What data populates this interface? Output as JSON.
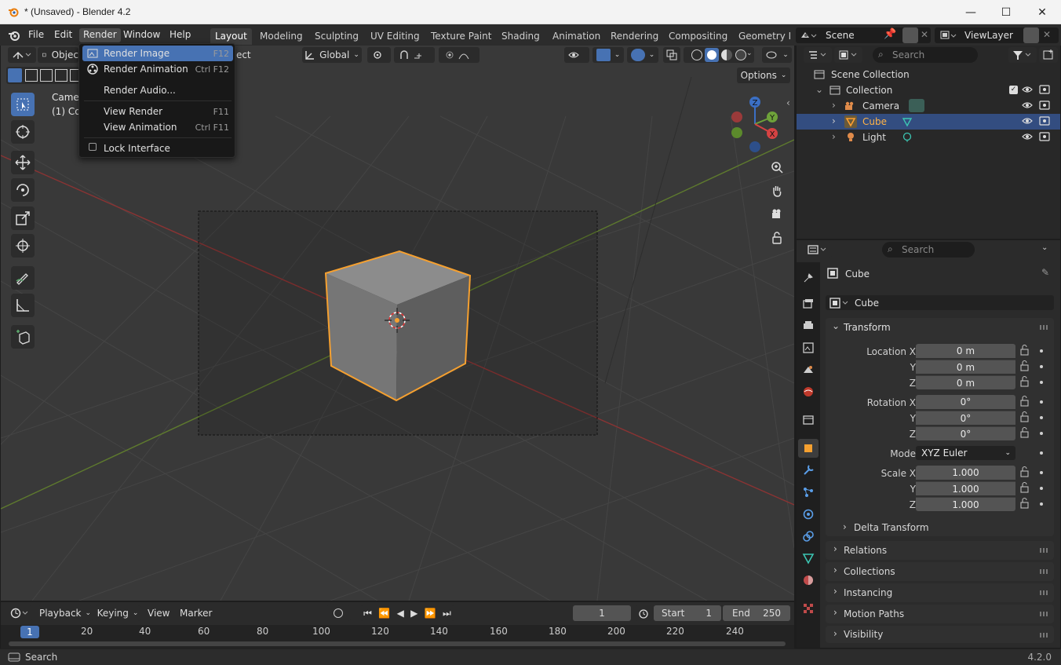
{
  "titlebar": {
    "title": "* (Unsaved) - Blender 4.2",
    "minimize": "—",
    "maximize": "☐",
    "close": "✕"
  },
  "menubar": {
    "items": [
      "File",
      "Edit",
      "Render",
      "Window",
      "Help"
    ]
  },
  "workspaces": [
    "Layout",
    "Modeling",
    "Sculpting",
    "UV Editing",
    "Texture Paint",
    "Shading",
    "Animation",
    "Rendering",
    "Compositing",
    "Geometry No"
  ],
  "scene": {
    "name": "Scene",
    "view_layer": "ViewLayer"
  },
  "viewport": {
    "mode_label": "Objec",
    "mode_partial": "Object",
    "transform_orientation": "Global",
    "options_label": "Options",
    "overlay_text_1": "Camer",
    "overlay_text_2": "(1) Co",
    "gizmo": {
      "x": "X",
      "y": "Y",
      "z": "Z"
    }
  },
  "render_menu": {
    "items": [
      {
        "label": "Render Image",
        "shortcut": "F12"
      },
      {
        "label": "Render Animation",
        "shortcut": "Ctrl F12"
      },
      {
        "label": "Render Audio...",
        "shortcut": ""
      },
      {
        "label": "View Render",
        "shortcut": "F11"
      },
      {
        "label": "View Animation",
        "shortcut": "Ctrl F11"
      },
      {
        "label": "Lock Interface",
        "shortcut": ""
      }
    ]
  },
  "outliner": {
    "search_placeholder": "Search",
    "rows": [
      {
        "label": "Scene Collection"
      },
      {
        "label": "Collection"
      },
      {
        "label": "Camera"
      },
      {
        "label": "Cube"
      },
      {
        "label": "Light"
      }
    ]
  },
  "properties": {
    "search_placeholder": "Search",
    "object_name": "Cube",
    "data_name": "Cube",
    "transform_title": "Transform",
    "location_label": "Location X",
    "y_label": "Y",
    "z_label": "Z",
    "rotation_label": "Rotation X",
    "mode_label": "Mode",
    "scale_label": "Scale X",
    "location": [
      "0 m",
      "0 m",
      "0 m"
    ],
    "rotation": [
      "0°",
      "0°",
      "0°"
    ],
    "rotation_mode": "XYZ Euler",
    "scale": [
      "1.000",
      "1.000",
      "1.000"
    ],
    "delta_transform": "Delta Transform",
    "sections": [
      "Relations",
      "Collections",
      "Instancing",
      "Motion Paths",
      "Visibility"
    ]
  },
  "timeline": {
    "menus": [
      "Playback",
      "Keying",
      "View",
      "Marker"
    ],
    "current_frame": "1",
    "start_label": "Start",
    "start": "1",
    "end_label": "End",
    "end": "250",
    "ruler": [
      "1",
      "20",
      "40",
      "60",
      "80",
      "100",
      "120",
      "140",
      "160",
      "180",
      "200",
      "220",
      "240"
    ]
  },
  "statusbar": {
    "left": "Search",
    "version": "4.2.0"
  },
  "colors": {
    "accent": "#4772b3",
    "selection_orange": "#ffa030",
    "x_axis": "#c0392b",
    "y_axis": "#6a9a2a"
  }
}
